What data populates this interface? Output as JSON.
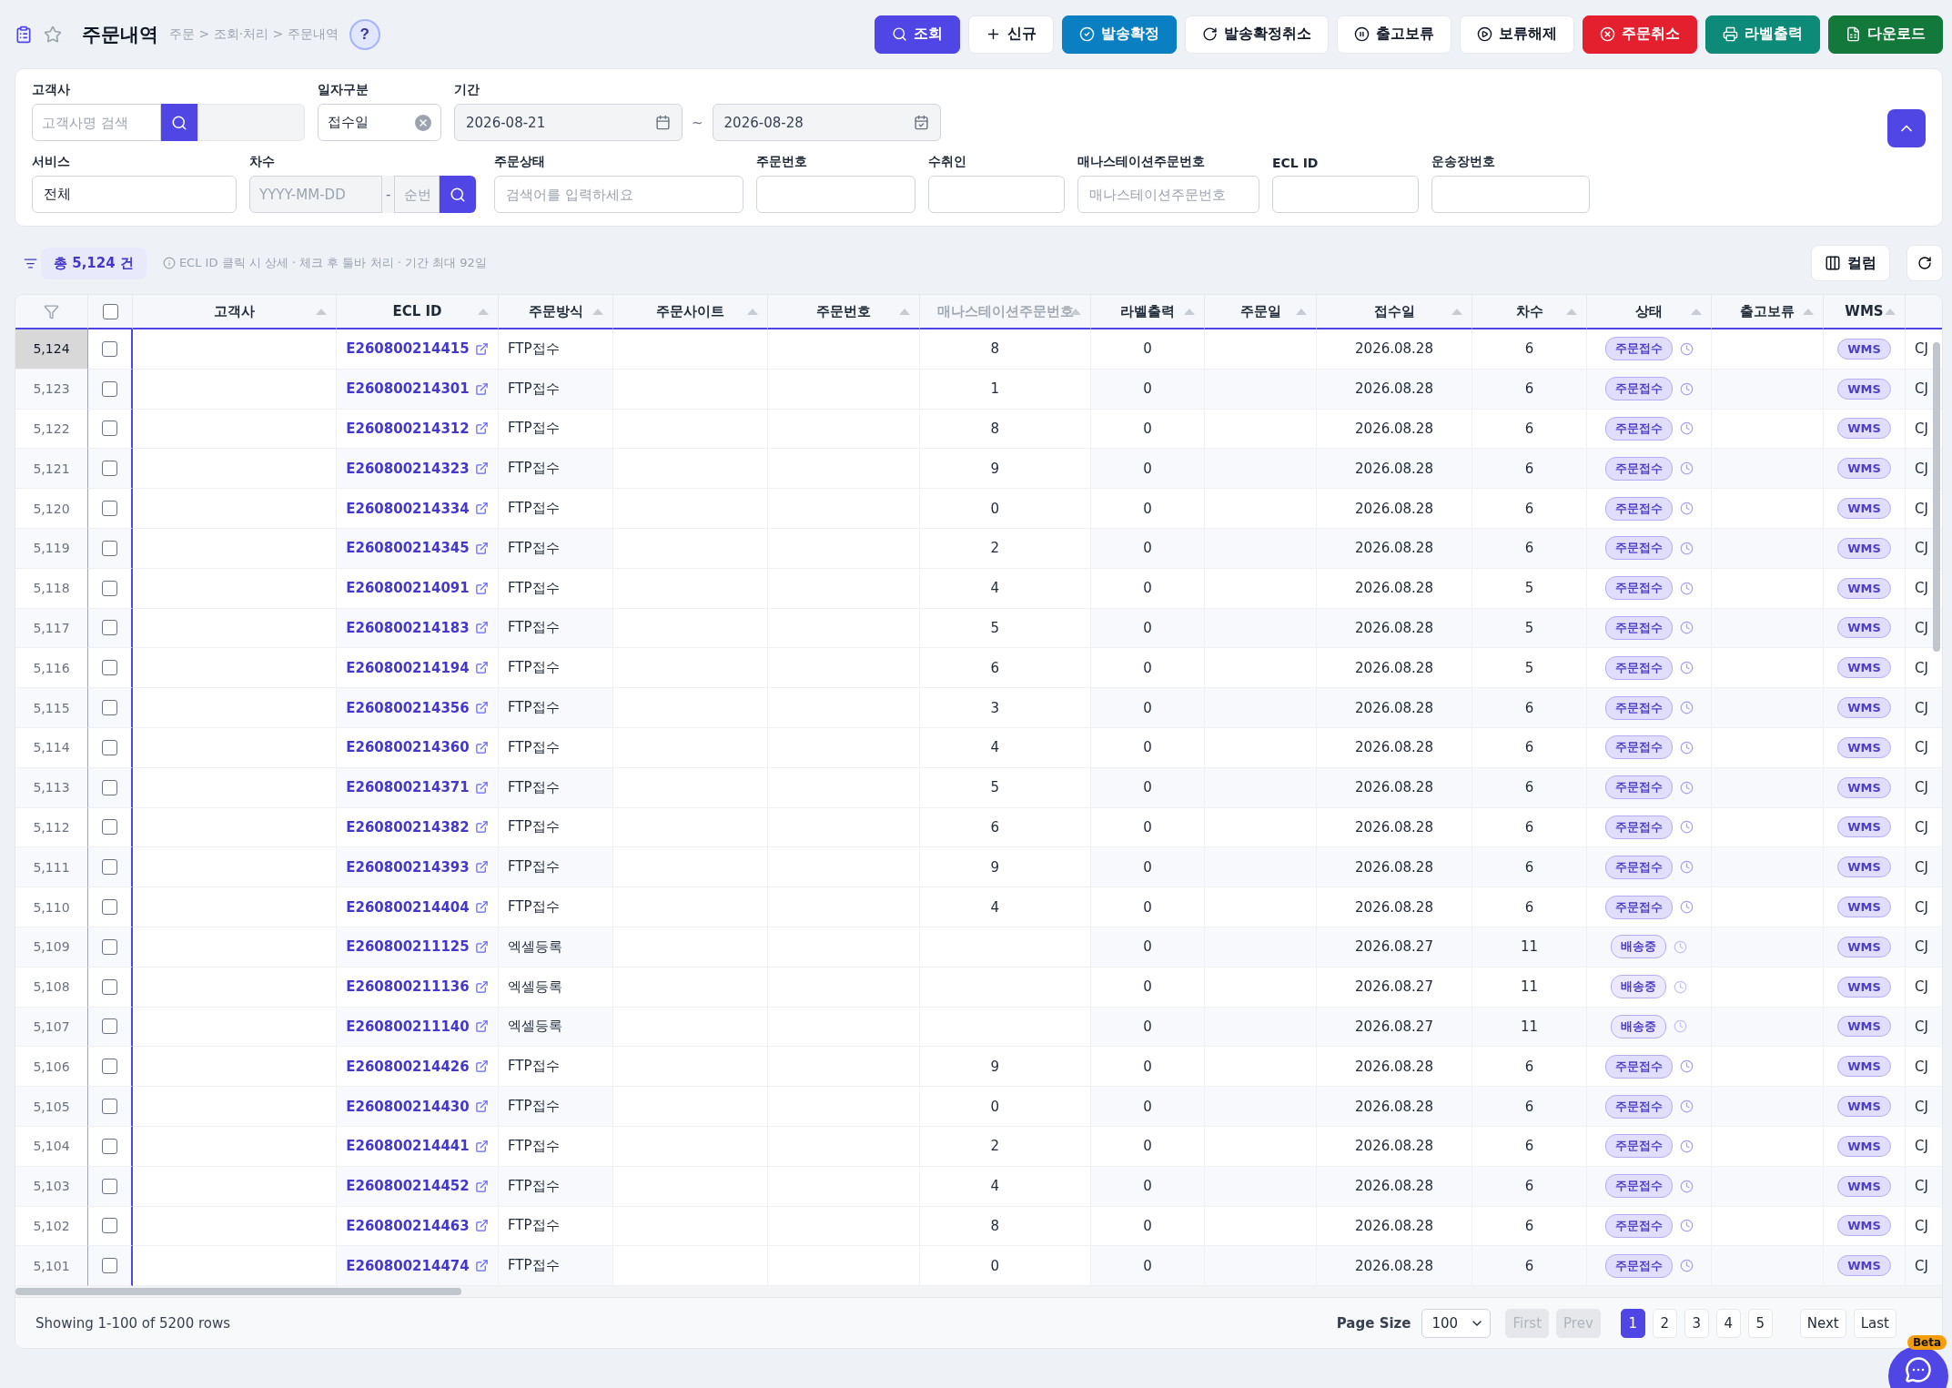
{
  "header": {
    "title": "주문내역",
    "breadcrumb": "주문 > 조회·처리 > 주문내역",
    "help": "?",
    "favorite": false
  },
  "actions": [
    {
      "label": "조회",
      "kind": "search"
    },
    {
      "label": "신규",
      "kind": "new"
    },
    {
      "label": "발송확정",
      "kind": "confirm"
    },
    {
      "label": "발송확정취소",
      "kind": "undo"
    },
    {
      "label": "출고보류",
      "kind": "hold"
    },
    {
      "label": "보류해제",
      "kind": "release"
    },
    {
      "label": "주문취소",
      "kind": "cancel"
    },
    {
      "label": "라벨출력",
      "kind": "print"
    },
    {
      "label": "다운로드",
      "kind": "download"
    }
  ],
  "filters": {
    "customer": {
      "label": "고객사",
      "placeholder": "고객사명 검색"
    },
    "date_type": {
      "label": "일자구분",
      "value": "접수일"
    },
    "period": {
      "label": "기간",
      "from": "2026-08-21",
      "separator": "~",
      "to": "2026-08-28"
    },
    "service": {
      "label": "서비스",
      "value": "전체"
    },
    "round": {
      "label": "차수",
      "date_placeholder": "YYYY-MM-DD",
      "separator": "-",
      "seq_placeholder": "순번"
    },
    "text_fields": [
      {
        "label": "주문상태",
        "placeholder": "검색어를 입력하세요"
      },
      {
        "label": "주문번호"
      },
      {
        "label": "수취인"
      },
      {
        "label": "매나스테이션주문번호",
        "placeholder": "매나스테이션주문번호"
      },
      {
        "label": "ECL ID"
      },
      {
        "label": "운송장번호"
      }
    ]
  },
  "summary": {
    "total": "총 5,124 건",
    "hint": "ECL ID 클릭 시 상세 · 체크 후 툴바 처리 · 기간 최대 92일"
  },
  "column_button": "컬럼",
  "table": {
    "all_checked": false,
    "columns": [
      {
        "label": "고객사",
        "masked": false
      },
      {
        "label": "ECL ID",
        "masked": false
      },
      {
        "label": "주문방식",
        "masked": false
      },
      {
        "label": "주문사이트",
        "masked": false
      },
      {
        "label": "주문번호",
        "masked": false
      },
      {
        "label": "매나스테이션주문번호",
        "masked": true
      },
      {
        "label": "라벨출력",
        "masked": false
      },
      {
        "label": "주문일",
        "masked": false
      },
      {
        "label": "접수일",
        "masked": false
      },
      {
        "label": "차수",
        "masked": false
      },
      {
        "label": "상태",
        "masked": false
      },
      {
        "label": "출고보류",
        "masked": false
      },
      {
        "label": "WMS",
        "masked": false
      }
    ],
    "rows": [
      {
        "no": "5,124",
        "selected": true,
        "checked": false,
        "ecl_id": "E260800214415",
        "method": "FTP접수",
        "mana_tail": "8",
        "label_count": "0",
        "received": "2026.08.28",
        "round": "6",
        "status": {
          "label": "주문접수",
          "kind": "received"
        },
        "wms": "WMS",
        "carrier": "CJ"
      },
      {
        "no": "5,123",
        "selected": false,
        "checked": false,
        "ecl_id": "E260800214301",
        "method": "FTP접수",
        "mana_tail": "1",
        "label_count": "0",
        "received": "2026.08.28",
        "round": "6",
        "status": {
          "label": "주문접수",
          "kind": "received"
        },
        "wms": "WMS",
        "carrier": "CJ"
      },
      {
        "no": "5,122",
        "selected": false,
        "checked": false,
        "ecl_id": "E260800214312",
        "method": "FTP접수",
        "mana_tail": "8",
        "label_count": "0",
        "received": "2026.08.28",
        "round": "6",
        "status": {
          "label": "주문접수",
          "kind": "received"
        },
        "wms": "WMS",
        "carrier": "CJ"
      },
      {
        "no": "5,121",
        "selected": false,
        "checked": false,
        "ecl_id": "E260800214323",
        "method": "FTP접수",
        "mana_tail": "9",
        "label_count": "0",
        "received": "2026.08.28",
        "round": "6",
        "status": {
          "label": "주문접수",
          "kind": "received"
        },
        "wms": "WMS",
        "carrier": "CJ"
      },
      {
        "no": "5,120",
        "selected": false,
        "checked": false,
        "ecl_id": "E260800214334",
        "method": "FTP접수",
        "mana_tail": "0",
        "label_count": "0",
        "received": "2026.08.28",
        "round": "6",
        "status": {
          "label": "주문접수",
          "kind": "received"
        },
        "wms": "WMS",
        "carrier": "CJ"
      },
      {
        "no": "5,119",
        "selected": false,
        "checked": false,
        "ecl_id": "E260800214345",
        "method": "FTP접수",
        "mana_tail": "2",
        "label_count": "0",
        "received": "2026.08.28",
        "round": "6",
        "status": {
          "label": "주문접수",
          "kind": "received"
        },
        "wms": "WMS",
        "carrier": "CJ"
      },
      {
        "no": "5,118",
        "selected": false,
        "checked": false,
        "ecl_id": "E260800214091",
        "method": "FTP접수",
        "mana_tail": "4",
        "label_count": "0",
        "received": "2026.08.28",
        "round": "5",
        "status": {
          "label": "주문접수",
          "kind": "received"
        },
        "wms": "WMS",
        "carrier": "CJ"
      },
      {
        "no": "5,117",
        "selected": false,
        "checked": false,
        "ecl_id": "E260800214183",
        "method": "FTP접수",
        "mana_tail": "5",
        "label_count": "0",
        "received": "2026.08.28",
        "round": "5",
        "status": {
          "label": "주문접수",
          "kind": "received"
        },
        "wms": "WMS",
        "carrier": "CJ"
      },
      {
        "no": "5,116",
        "selected": false,
        "checked": false,
        "ecl_id": "E260800214194",
        "method": "FTP접수",
        "mana_tail": "6",
        "label_count": "0",
        "received": "2026.08.28",
        "round": "5",
        "status": {
          "label": "주문접수",
          "kind": "received"
        },
        "wms": "WMS",
        "carrier": "CJ"
      },
      {
        "no": "5,115",
        "selected": false,
        "checked": false,
        "ecl_id": "E260800214356",
        "method": "FTP접수",
        "mana_tail": "3",
        "label_count": "0",
        "received": "2026.08.28",
        "round": "6",
        "status": {
          "label": "주문접수",
          "kind": "received"
        },
        "wms": "WMS",
        "carrier": "CJ"
      },
      {
        "no": "5,114",
        "selected": false,
        "checked": false,
        "ecl_id": "E260800214360",
        "method": "FTP접수",
        "mana_tail": "4",
        "label_count": "0",
        "received": "2026.08.28",
        "round": "6",
        "status": {
          "label": "주문접수",
          "kind": "received"
        },
        "wms": "WMS",
        "carrier": "CJ"
      },
      {
        "no": "5,113",
        "selected": false,
        "checked": false,
        "ecl_id": "E260800214371",
        "method": "FTP접수",
        "mana_tail": "5",
        "label_count": "0",
        "received": "2026.08.28",
        "round": "6",
        "status": {
          "label": "주문접수",
          "kind": "received"
        },
        "wms": "WMS",
        "carrier": "CJ"
      },
      {
        "no": "5,112",
        "selected": false,
        "checked": false,
        "ecl_id": "E260800214382",
        "method": "FTP접수",
        "mana_tail": "6",
        "label_count": "0",
        "received": "2026.08.28",
        "round": "6",
        "status": {
          "label": "주문접수",
          "kind": "received"
        },
        "wms": "WMS",
        "carrier": "CJ"
      },
      {
        "no": "5,111",
        "selected": false,
        "checked": false,
        "ecl_id": "E260800214393",
        "method": "FTP접수",
        "mana_tail": "9",
        "label_count": "0",
        "received": "2026.08.28",
        "round": "6",
        "status": {
          "label": "주문접수",
          "kind": "received"
        },
        "wms": "WMS",
        "carrier": "CJ"
      },
      {
        "no": "5,110",
        "selected": false,
        "checked": false,
        "ecl_id": "E260800214404",
        "method": "FTP접수",
        "mana_tail": "4",
        "label_count": "0",
        "received": "2026.08.28",
        "round": "6",
        "status": {
          "label": "주문접수",
          "kind": "received"
        },
        "wms": "WMS",
        "carrier": "CJ"
      },
      {
        "no": "5,109",
        "selected": false,
        "checked": false,
        "ecl_id": "E260800211125",
        "method": "엑셀등록",
        "label_count": "0",
        "received": "2026.08.27",
        "round": "11",
        "status": {
          "label": "배송중",
          "kind": "shipping"
        },
        "wms": "WMS",
        "carrier": "CJ"
      },
      {
        "no": "5,108",
        "selected": false,
        "checked": false,
        "ecl_id": "E260800211136",
        "method": "엑셀등록",
        "label_count": "0",
        "received": "2026.08.27",
        "round": "11",
        "status": {
          "label": "배송중",
          "kind": "shipping"
        },
        "wms": "WMS",
        "carrier": "CJ"
      },
      {
        "no": "5,107",
        "selected": false,
        "checked": false,
        "ecl_id": "E260800211140",
        "method": "엑셀등록",
        "label_count": "0",
        "received": "2026.08.27",
        "round": "11",
        "status": {
          "label": "배송중",
          "kind": "shipping"
        },
        "wms": "WMS",
        "carrier": "CJ"
      },
      {
        "no": "5,106",
        "selected": false,
        "checked": false,
        "ecl_id": "E260800214426",
        "method": "FTP접수",
        "mana_tail": "9",
        "label_count": "0",
        "received": "2026.08.28",
        "round": "6",
        "status": {
          "label": "주문접수",
          "kind": "received"
        },
        "wms": "WMS",
        "carrier": "CJ"
      },
      {
        "no": "5,105",
        "selected": false,
        "checked": false,
        "ecl_id": "E260800214430",
        "method": "FTP접수",
        "mana_tail": "0",
        "label_count": "0",
        "received": "2026.08.28",
        "round": "6",
        "status": {
          "label": "주문접수",
          "kind": "received"
        },
        "wms": "WMS",
        "carrier": "CJ"
      },
      {
        "no": "5,104",
        "selected": false,
        "checked": false,
        "ecl_id": "E260800214441",
        "method": "FTP접수",
        "mana_tail": "2",
        "label_count": "0",
        "received": "2026.08.28",
        "round": "6",
        "status": {
          "label": "주문접수",
          "kind": "received"
        },
        "wms": "WMS",
        "carrier": "CJ"
      },
      {
        "no": "5,103",
        "selected": false,
        "checked": false,
        "ecl_id": "E260800214452",
        "method": "FTP접수",
        "mana_tail": "4",
        "label_count": "0",
        "received": "2026.08.28",
        "round": "6",
        "status": {
          "label": "주문접수",
          "kind": "received"
        },
        "wms": "WMS",
        "carrier": "CJ"
      },
      {
        "no": "5,102",
        "selected": false,
        "checked": false,
        "ecl_id": "E260800214463",
        "method": "FTP접수",
        "mana_tail": "8",
        "label_count": "0",
        "received": "2026.08.28",
        "round": "6",
        "status": {
          "label": "주문접수",
          "kind": "received"
        },
        "wms": "WMS",
        "carrier": "CJ"
      },
      {
        "no": "5,101",
        "selected": false,
        "checked": false,
        "ecl_id": "E260800214474",
        "method": "FTP접수",
        "mana_tail": "0",
        "label_count": "0",
        "received": "2026.08.28",
        "round": "6",
        "status": {
          "label": "주문접수",
          "kind": "received"
        },
        "wms": "WMS",
        "carrier": "CJ"
      }
    ]
  },
  "footer": {
    "showing": "Showing 1-100 of 5200 rows",
    "page_size_label": "Page Size",
    "page_size": "100",
    "nav": [
      {
        "label": "First",
        "disabled": true
      },
      {
        "label": "Prev",
        "disabled": true
      }
    ],
    "pages": [
      {
        "label": "1",
        "selected": true
      },
      {
        "label": "2",
        "selected": false
      },
      {
        "label": "3",
        "selected": false
      },
      {
        "label": "4",
        "selected": false
      },
      {
        "label": "5",
        "selected": false
      }
    ],
    "nav_after": [
      {
        "label": "Next",
        "disabled": false
      },
      {
        "label": "Last",
        "disabled": false
      }
    ]
  },
  "chat": {
    "badge": "Beta"
  }
}
